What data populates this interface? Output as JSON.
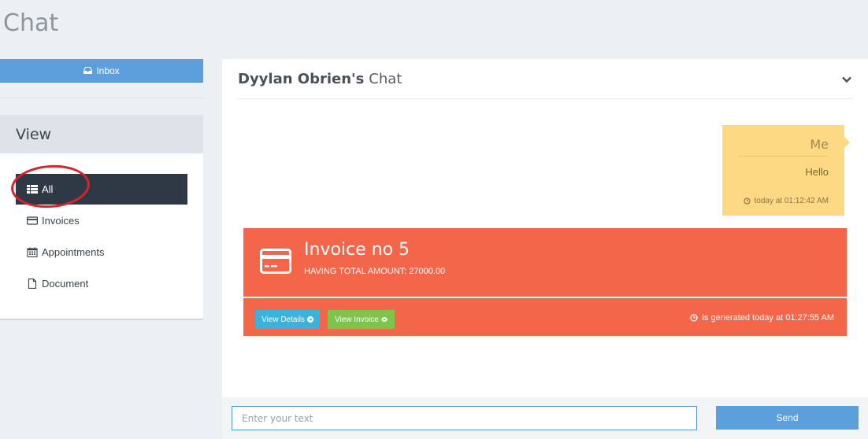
{
  "page": {
    "title": "Chat"
  },
  "sidebar": {
    "inbox_label": "Inbox",
    "view_title": "View",
    "items": [
      {
        "label": "All",
        "icon": "grid-icon",
        "active": true
      },
      {
        "label": "Invoices",
        "icon": "credit-card-icon",
        "active": false
      },
      {
        "label": "Appointments",
        "icon": "calendar-icon",
        "active": false
      },
      {
        "label": "Document",
        "icon": "document-icon",
        "active": false
      }
    ]
  },
  "chat": {
    "contact_name": "Dyylan Obrien's",
    "title_suffix": "Chat",
    "message": {
      "sender": "Me",
      "text": "Hello",
      "time": "today at 01:12:42 AM"
    },
    "invoice": {
      "title": "Invoice no 5",
      "total": "HAVING TOTAL AMOUNT: 27000.00",
      "details_label": "View Details",
      "view_label": "View Invoice",
      "generated": "is generated today at 01:27:55 AM"
    },
    "input_placeholder": "Enter your text",
    "send_label": "Send"
  },
  "colors": {
    "accent_blue": "#5b9fdc",
    "sidebar_active": "#2f3945",
    "bubble": "#fdd984",
    "invoice": "#f4664a",
    "details_button": "#3bb2db",
    "invoice_button": "#7ec44a",
    "annotation_ring": "#d9232c"
  }
}
